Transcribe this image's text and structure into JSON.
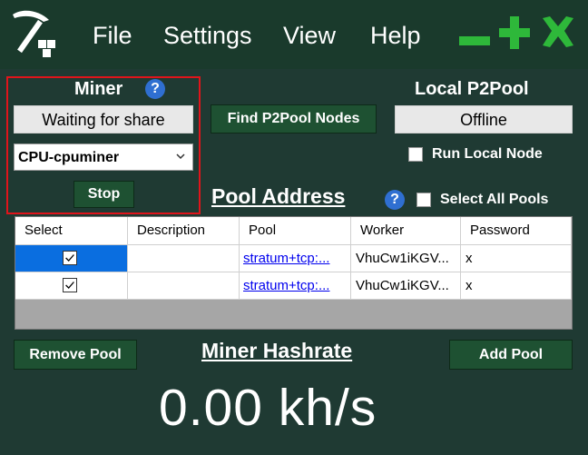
{
  "menu": {
    "items": [
      "File",
      "Settings",
      "View",
      "Help"
    ]
  },
  "miner": {
    "title": "Miner",
    "status_button": "Waiting for share",
    "selected_miner": "CPU-cpuminer",
    "stop_button": "Stop"
  },
  "p2pool": {
    "find_button": "Find P2Pool Nodes",
    "local_title": "Local P2Pool",
    "status_button": "Offline",
    "run_local_label": "Run Local Node",
    "run_local_checked": false
  },
  "pool": {
    "title": "Pool Address",
    "select_all_label": "Select All Pools",
    "select_all_checked": false,
    "columns": [
      "Select",
      "Description",
      "Pool",
      "Worker",
      "Password"
    ],
    "rows": [
      {
        "selected": true,
        "description": "",
        "pool": "stratum+tcp:...",
        "worker": "VhuCw1iKGV...",
        "password": "x"
      },
      {
        "selected": true,
        "description": "",
        "pool": "stratum+tcp:...",
        "worker": "VhuCw1iKGV...",
        "password": "x"
      }
    ]
  },
  "actions": {
    "remove_pool": "Remove Pool",
    "add_pool": "Add Pool"
  },
  "hashrate": {
    "title": "Miner Hashrate",
    "value": "0.00 kh/s"
  },
  "colors": {
    "background": "#1f3a33",
    "menubar": "#1a3a2c",
    "window_controls": "#2eb83a",
    "green_button": "#1e5132",
    "highlight": "#e0141b",
    "selection": "#0a6ee0"
  },
  "icons": {
    "logo": "pickaxe-blocks-icon",
    "help": "question-icon",
    "minimize": "minimize-icon",
    "maximize": "plus-icon",
    "close": "close-icon"
  }
}
